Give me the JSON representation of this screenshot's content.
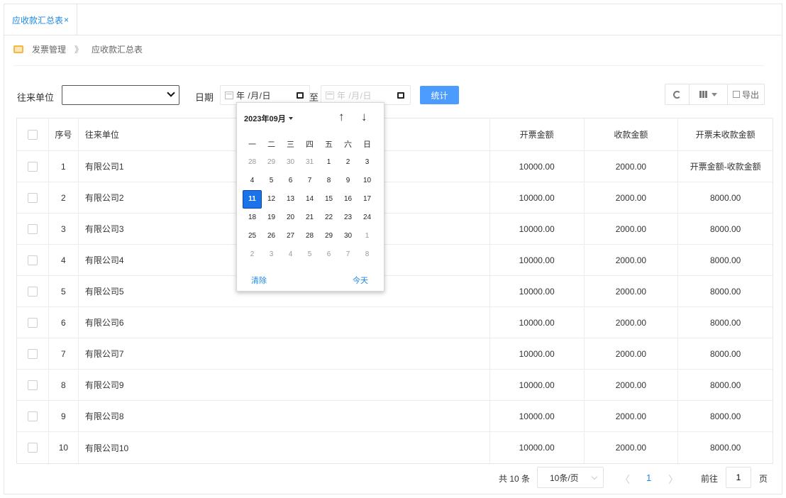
{
  "tab": {
    "label": "应收款汇总表",
    "close": "×"
  },
  "breadcrumb": {
    "parent": "发票管理",
    "separator": "》",
    "current": "应收款汇总表"
  },
  "filters": {
    "partner_label": "往来单位",
    "partner_value": "",
    "date_label": "日期",
    "date_from": "年 /月/日",
    "to_label": "至",
    "date_to": "年 /月/日",
    "stat_button": "统计"
  },
  "toolbar": {
    "export_label": "导出"
  },
  "table": {
    "headers": {
      "seq": "序号",
      "partner": "往来单位",
      "invoiced": "开票金额",
      "received": "收款金额",
      "unreceived": "开票未收款金额"
    },
    "rows": [
      {
        "seq": "1",
        "partner": "有限公司1",
        "invoiced": "10000.00",
        "received": "2000.00",
        "unreceived": "开票金额-收款金额"
      },
      {
        "seq": "2",
        "partner": "有限公司2",
        "invoiced": "10000.00",
        "received": "2000.00",
        "unreceived": "8000.00"
      },
      {
        "seq": "3",
        "partner": "有限公司3",
        "invoiced": "10000.00",
        "received": "2000.00",
        "unreceived": "8000.00"
      },
      {
        "seq": "4",
        "partner": "有限公司4",
        "invoiced": "10000.00",
        "received": "2000.00",
        "unreceived": "8000.00"
      },
      {
        "seq": "5",
        "partner": "有限公司5",
        "invoiced": "10000.00",
        "received": "2000.00",
        "unreceived": "8000.00"
      },
      {
        "seq": "6",
        "partner": "有限公司6",
        "invoiced": "10000.00",
        "received": "2000.00",
        "unreceived": "8000.00"
      },
      {
        "seq": "7",
        "partner": "有限公司7",
        "invoiced": "10000.00",
        "received": "2000.00",
        "unreceived": "8000.00"
      },
      {
        "seq": "8",
        "partner": "有限公司9",
        "invoiced": "10000.00",
        "received": "2000.00",
        "unreceived": "8000.00"
      },
      {
        "seq": "9",
        "partner": "有限公司8",
        "invoiced": "10000.00",
        "received": "2000.00",
        "unreceived": "8000.00"
      },
      {
        "seq": "10",
        "partner": "有限公司10",
        "invoiced": "10000.00",
        "received": "2000.00",
        "unreceived": "8000.00"
      }
    ]
  },
  "pagination": {
    "total": "共 10 条",
    "page_size": "10条/页",
    "prev": "〈",
    "current": "1",
    "next": "〉",
    "goto_label": "前往",
    "goto_value": "1",
    "page_label": "页"
  },
  "calendar": {
    "month_label": "2023年09月",
    "up": "↑",
    "down": "↓",
    "weekdays": [
      "一",
      "二",
      "三",
      "四",
      "五",
      "六",
      "日"
    ],
    "weeks": [
      [
        {
          "d": "28",
          "m": true
        },
        {
          "d": "29",
          "m": true
        },
        {
          "d": "30",
          "m": true
        },
        {
          "d": "31",
          "m": true
        },
        {
          "d": "1"
        },
        {
          "d": "2"
        },
        {
          "d": "3"
        }
      ],
      [
        {
          "d": "4"
        },
        {
          "d": "5"
        },
        {
          "d": "6"
        },
        {
          "d": "7"
        },
        {
          "d": "8"
        },
        {
          "d": "9"
        },
        {
          "d": "10"
        }
      ],
      [
        {
          "d": "11",
          "s": true
        },
        {
          "d": "12"
        },
        {
          "d": "13"
        },
        {
          "d": "14"
        },
        {
          "d": "15"
        },
        {
          "d": "16"
        },
        {
          "d": "17"
        }
      ],
      [
        {
          "d": "18"
        },
        {
          "d": "19"
        },
        {
          "d": "20"
        },
        {
          "d": "21"
        },
        {
          "d": "22"
        },
        {
          "d": "23"
        },
        {
          "d": "24"
        }
      ],
      [
        {
          "d": "25"
        },
        {
          "d": "26"
        },
        {
          "d": "27"
        },
        {
          "d": "28"
        },
        {
          "d": "29"
        },
        {
          "d": "30"
        },
        {
          "d": "1",
          "m": true
        }
      ],
      [
        {
          "d": "2",
          "m": true
        },
        {
          "d": "3",
          "m": true
        },
        {
          "d": "4",
          "m": true
        },
        {
          "d": "5",
          "m": true
        },
        {
          "d": "6",
          "m": true
        },
        {
          "d": "7",
          "m": true
        },
        {
          "d": "8",
          "m": true
        }
      ]
    ],
    "clear": "清除",
    "today": "今天"
  },
  "colors": {
    "accent": "#1e88e5",
    "button": "#4c9bff",
    "selected_day": "#1a73e8"
  }
}
